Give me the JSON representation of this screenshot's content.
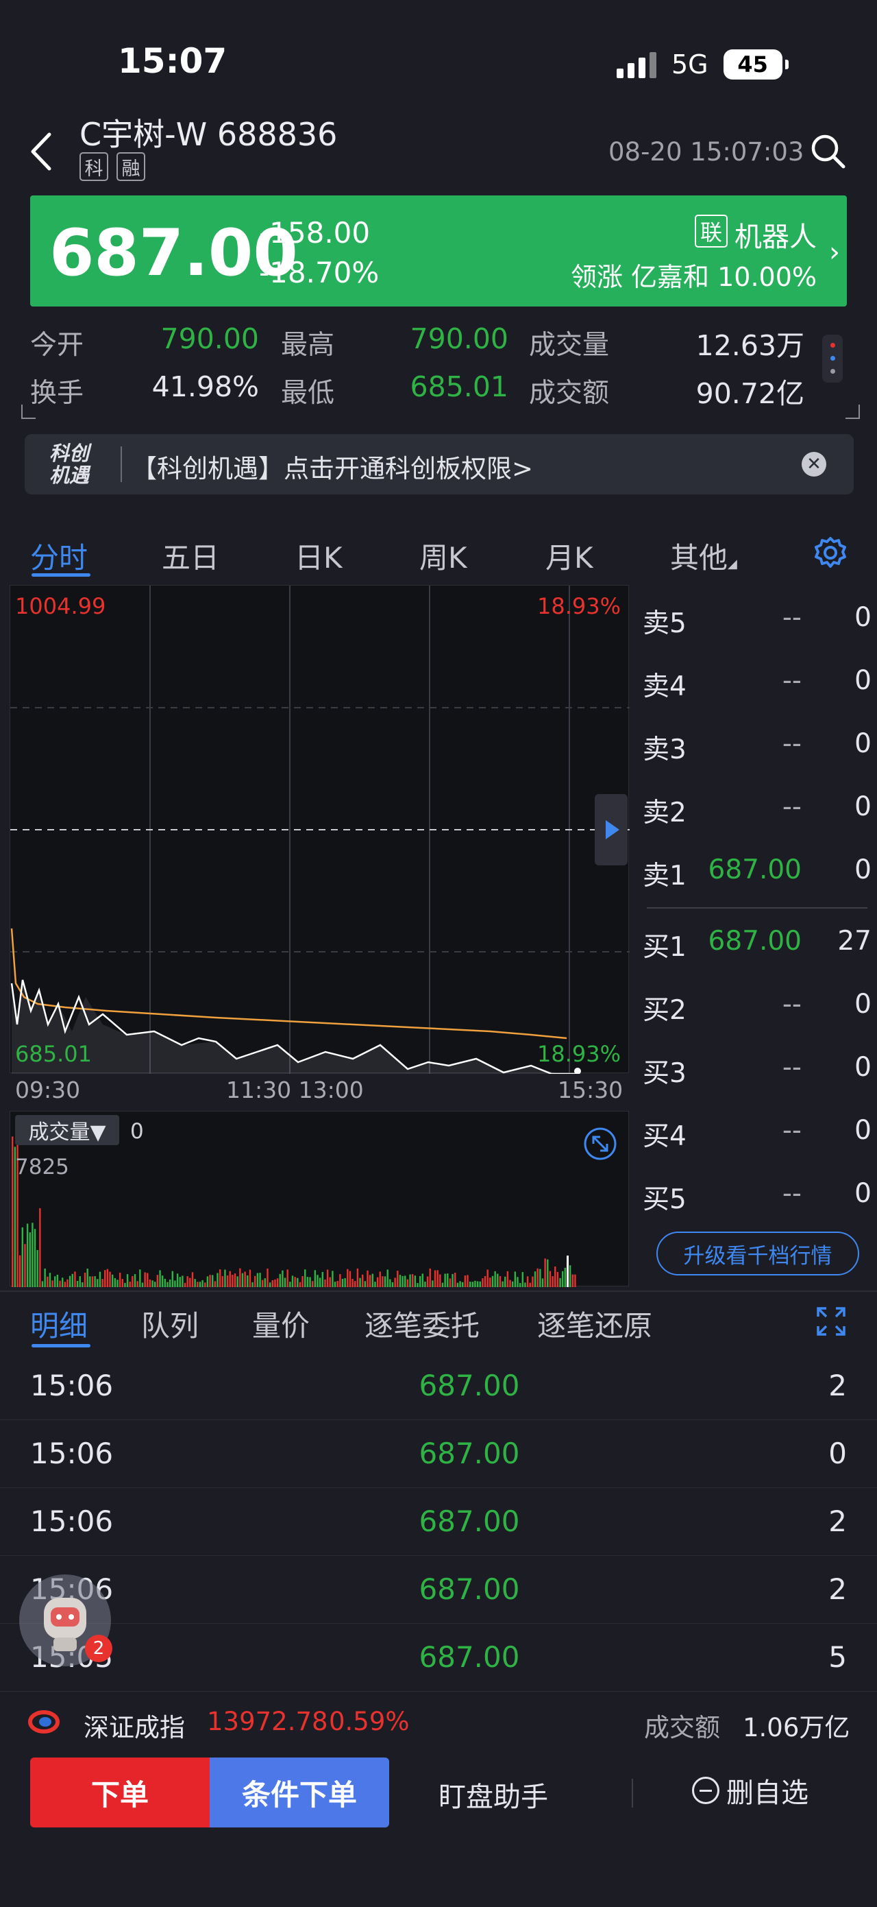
{
  "status": {
    "time": "15:07",
    "network": "5G",
    "battery": "45"
  },
  "header": {
    "stock_name": "C宇树-W 688836",
    "tags": [
      "科",
      "融"
    ],
    "timestamp": "08-20 15:07:03"
  },
  "price": {
    "last": "687.00",
    "change": "-158.00",
    "change_pct": "-18.70%",
    "concept_badge": "联",
    "concept": "机器人",
    "lead_line": "领涨 亿嘉和 10.00%",
    "color": "#27b05b"
  },
  "stats": {
    "open_label": "今开",
    "open": "790.00",
    "high_label": "最高",
    "high": "790.00",
    "vol_label": "成交量",
    "vol": "12.63万",
    "turnover_label": "换手",
    "turnover": "41.98%",
    "low_label": "最低",
    "low": "685.01",
    "amount_label": "成交额",
    "amount": "90.72亿"
  },
  "promo": {
    "logo_line1": "科创",
    "logo_line2": "机遇",
    "text": "【科创机遇】点击开通科创板权限>"
  },
  "chart_tabs": [
    "分时",
    "五日",
    "日K",
    "周K",
    "月K",
    "其他"
  ],
  "chart": {
    "high_price": "1004.99",
    "high_pct": "18.93%",
    "low_price": "685.01",
    "low_pct": "18.93%",
    "time_labels": [
      "09:30",
      "11:30 13:00",
      "15:30"
    ],
    "volume_select": "成交量▼",
    "volume_current": "0",
    "volume_max": "7825"
  },
  "chart_data": {
    "type": "line",
    "x_labels": [
      "09:30",
      "11:30 13:00",
      "15:30"
    ],
    "ylim": [
      685.01,
      1004.99
    ],
    "series": [],
    "volume_ylim": [
      0,
      7825
    ]
  },
  "order_book": {
    "asks": [
      {
        "label": "卖5",
        "price": "--",
        "qty": "0"
      },
      {
        "label": "卖4",
        "price": "--",
        "qty": "0"
      },
      {
        "label": "卖3",
        "price": "--",
        "qty": "0"
      },
      {
        "label": "卖2",
        "price": "--",
        "qty": "0"
      },
      {
        "label": "卖1",
        "price": "687.00",
        "qty": "0"
      }
    ],
    "bids": [
      {
        "label": "买1",
        "price": "687.00",
        "qty": "27"
      },
      {
        "label": "买2",
        "price": "--",
        "qty": "0"
      },
      {
        "label": "买3",
        "price": "--",
        "qty": "0"
      },
      {
        "label": "买4",
        "price": "--",
        "qty": "0"
      },
      {
        "label": "买5",
        "price": "--",
        "qty": "0"
      }
    ],
    "upgrade_label": "升级看千档行情"
  },
  "detail_tabs": [
    "明细",
    "队列",
    "量价",
    "逐笔委托",
    "逐笔还原"
  ],
  "ticks": [
    {
      "time": "15:06",
      "price": "687.00",
      "vol": "2"
    },
    {
      "time": "15:06",
      "price": "687.00",
      "vol": "0"
    },
    {
      "time": "15:06",
      "price": "687.00",
      "vol": "2"
    },
    {
      "time": "15:06",
      "price": "687.00",
      "vol": "2"
    },
    {
      "time": "15:05",
      "price": "687.00",
      "vol": "5"
    }
  ],
  "float_badge": "2",
  "index_bar": {
    "name": "深证成指",
    "value": "13972.78",
    "pct": "0.59%",
    "amount_label": "成交额",
    "amount": "1.06万亿"
  },
  "actions": {
    "order": "下单",
    "cond_order": "条件下单",
    "monitor": "盯盘助手",
    "remove_fav": "删自选"
  }
}
